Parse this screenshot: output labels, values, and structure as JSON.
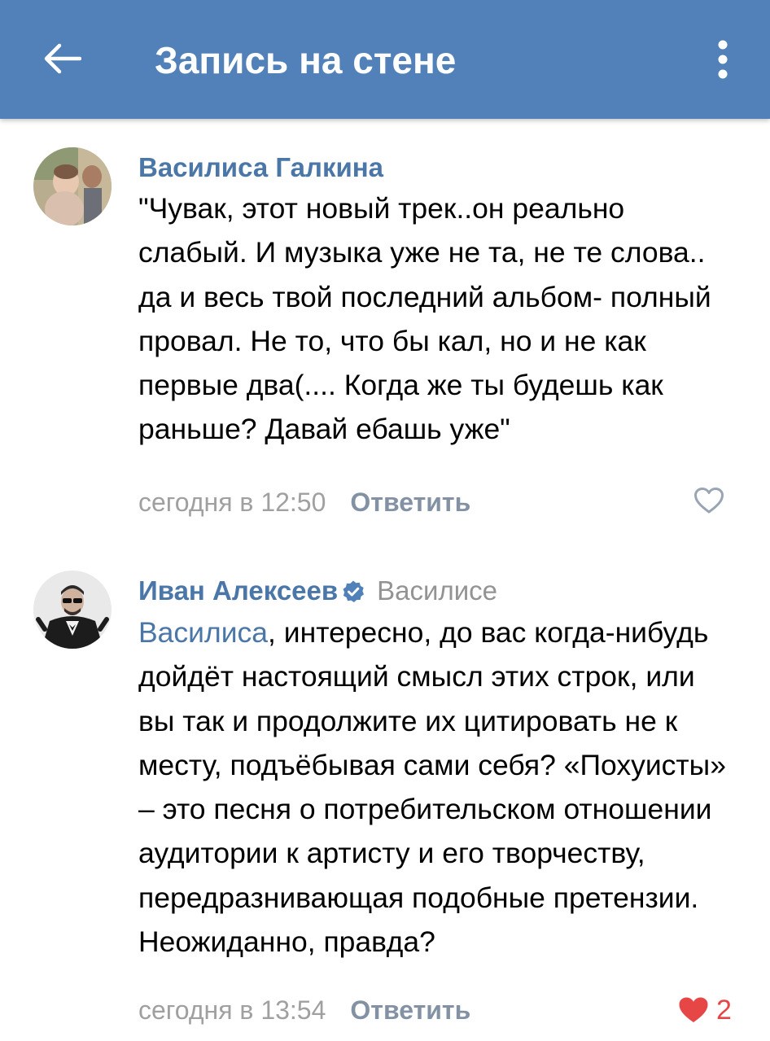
{
  "header": {
    "title": "Запись на стене",
    "back_icon": "arrow-left-icon",
    "menu_icon": "more-vertical-icon",
    "background": "#5181b8"
  },
  "comments": [
    {
      "author": "Василиса Галкина",
      "avatar": "avatar-photo-baby",
      "text": "\"Чувак, этот новый трек..он реально слабый. И музыка уже не та, не те слова.. да и весь твой последний альбом- полный провал. Не то, что бы кал, но и не как первые два(.... Когда же ты будешь как раньше? Давай ебашь уже\"",
      "time": "сегодня в 12:50",
      "reply_label": "Ответить",
      "liked": false,
      "likes": ""
    },
    {
      "author": "Иван Алексеев",
      "verified": true,
      "reply_to": "Василисе",
      "avatar": "avatar-photo-man",
      "mention": "Василиса",
      "text": ", интересно, до вас когда-нибудь дойдёт настоящий смысл этих строк, или вы так и продолжите их цитировать не к месту, подъёбывая сами себя? «Похуисты» – это песня о потребительском отношении аудитории к артисту и его творчеству, передразнивающая подобные претензии. Неожиданно, правда?",
      "time": "сегодня в 13:54",
      "reply_label": "Ответить",
      "liked": true,
      "likes": "2"
    }
  ],
  "colors": {
    "link": "#4a76a8",
    "meta": "#a0a0a0",
    "like_active": "#e64646"
  }
}
